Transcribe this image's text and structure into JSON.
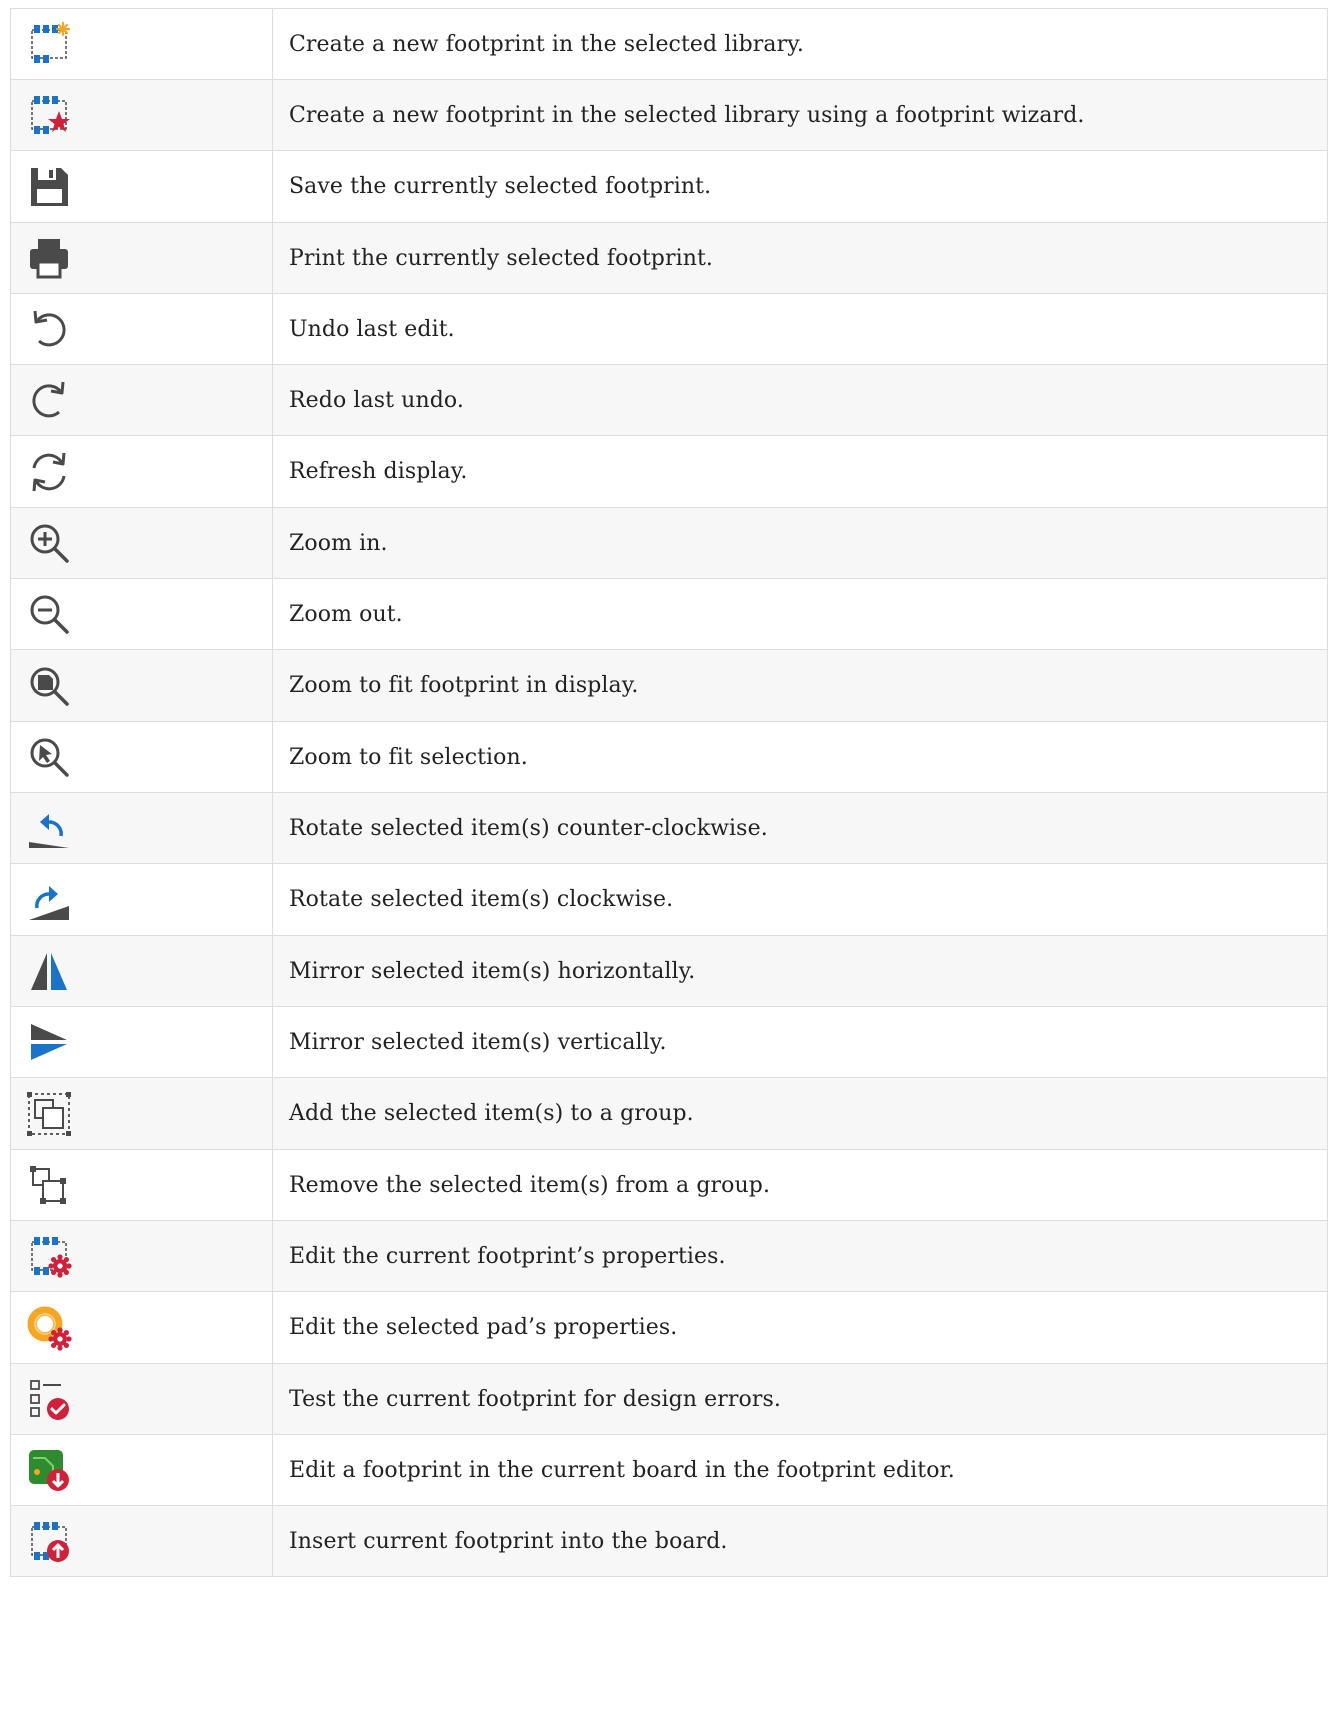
{
  "rows": [
    {
      "icon": "new-footprint-icon",
      "text": "Create a new footprint in the selected library."
    },
    {
      "icon": "footprint-wizard-icon",
      "text": "Create a new footprint in the selected library using a footprint wizard."
    },
    {
      "icon": "save-icon",
      "text": "Save the currently selected footprint."
    },
    {
      "icon": "print-icon",
      "text": "Print the currently selected footprint."
    },
    {
      "icon": "undo-icon",
      "text": "Undo last edit."
    },
    {
      "icon": "redo-icon",
      "text": "Redo last undo."
    },
    {
      "icon": "refresh-icon",
      "text": "Refresh display."
    },
    {
      "icon": "zoom-in-icon",
      "text": "Zoom in."
    },
    {
      "icon": "zoom-out-icon",
      "text": "Zoom out."
    },
    {
      "icon": "zoom-fit-icon",
      "text": "Zoom to fit footprint in display."
    },
    {
      "icon": "zoom-selection-icon",
      "text": "Zoom to fit selection."
    },
    {
      "icon": "rotate-ccw-icon",
      "text": "Rotate selected item(s) counter-clockwise."
    },
    {
      "icon": "rotate-cw-icon",
      "text": "Rotate selected item(s) clockwise."
    },
    {
      "icon": "mirror-horizontal-icon",
      "text": "Mirror selected item(s) horizontally."
    },
    {
      "icon": "mirror-vertical-icon",
      "text": "Mirror selected item(s) vertically."
    },
    {
      "icon": "group-icon",
      "text": "Add the selected item(s) to a group."
    },
    {
      "icon": "ungroup-icon",
      "text": "Remove the selected item(s) from a group."
    },
    {
      "icon": "footprint-properties-icon",
      "text": "Edit the current footprint’s properties."
    },
    {
      "icon": "pad-properties-icon",
      "text": "Edit the selected pad’s properties."
    },
    {
      "icon": "footprint-checker-icon",
      "text": "Test the current footprint for design errors."
    },
    {
      "icon": "load-from-board-icon",
      "text": "Edit a footprint in the current board in the footprint editor."
    },
    {
      "icon": "insert-into-board-icon",
      "text": "Insert current footprint into the board."
    }
  ],
  "colors": {
    "blue": "#1a73c8",
    "gray": "#4a4a4a",
    "red": "#d0203a",
    "orange": "#f5a623",
    "green": "#2e8b2e",
    "border": "#dddddd",
    "row_alt": "#f7f7f7"
  }
}
